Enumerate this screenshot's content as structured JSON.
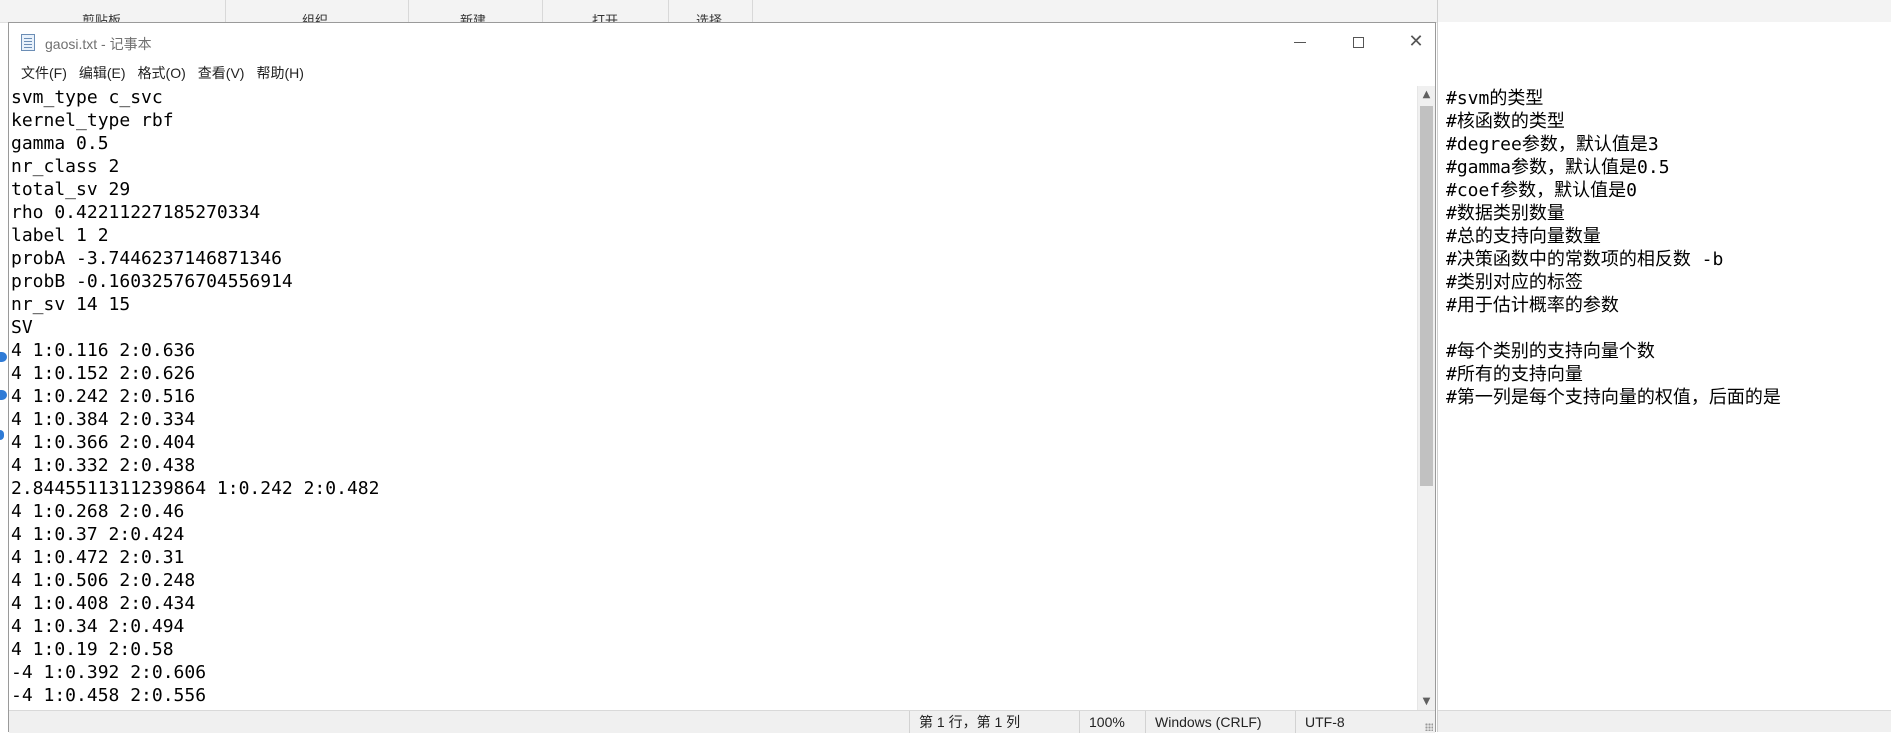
{
  "background_ribbon": {
    "items": [
      "剪贴板",
      "组织",
      "新建",
      "打开",
      "选择"
    ]
  },
  "window": {
    "title": "gaosi.txt - 记事本",
    "minimize_glyph": "—",
    "maximize_glyph": "☐",
    "close_glyph": "✕"
  },
  "menu": [
    "文件(F)",
    "编辑(E)",
    "格式(O)",
    "查看(V)",
    "帮助(H)"
  ],
  "editor_lines": [
    "svm_type c_svc",
    "kernel_type rbf",
    "gamma 0.5",
    "nr_class 2",
    "total_sv 29",
    "rho 0.42211227185270334",
    "label 1 2",
    "probA -3.7446237146871346",
    "probB -0.16032576704556914",
    "nr_sv 14 15",
    "SV",
    "4 1:0.116 2:0.636",
    "4 1:0.152 2:0.626",
    "4 1:0.242 2:0.516",
    "4 1:0.384 2:0.334",
    "4 1:0.366 2:0.404",
    "4 1:0.332 2:0.438",
    "2.8445511311239864 1:0.242 2:0.482",
    "4 1:0.268 2:0.46",
    "4 1:0.37 2:0.424",
    "4 1:0.472 2:0.31",
    "4 1:0.506 2:0.248",
    "4 1:0.408 2:0.434",
    "4 1:0.34 2:0.494",
    "4 1:0.19 2:0.58",
    "-4 1:0.392 2:0.606",
    "-4 1:0.458 2:0.556"
  ],
  "statusbar": {
    "position": "第 1 行，第 1 列",
    "zoom": "100%",
    "line_ending": "Windows (CRLF)",
    "encoding": "UTF-8"
  },
  "comments": [
    "#svm的类型",
    "#核函数的类型",
    "#degree参数，默认值是3",
    "#gamma参数，默认值是0.5",
    "#coef参数，默认值是0",
    "#数据类别数量",
    "#总的支持向量数量",
    "#决策函数中的常数项的相反数 -b",
    "#类别对应的标签",
    "#用于估计概率的参数",
    "",
    "#每个类别的支持向量个数",
    "#所有的支持向量",
    "#第一列是每个支持向量的权值，后面的是"
  ],
  "colors": {
    "accent": "#2f7bd6",
    "scroll_thumb": "#c1c1c1",
    "statusbar_bg": "#f0f0f0"
  }
}
